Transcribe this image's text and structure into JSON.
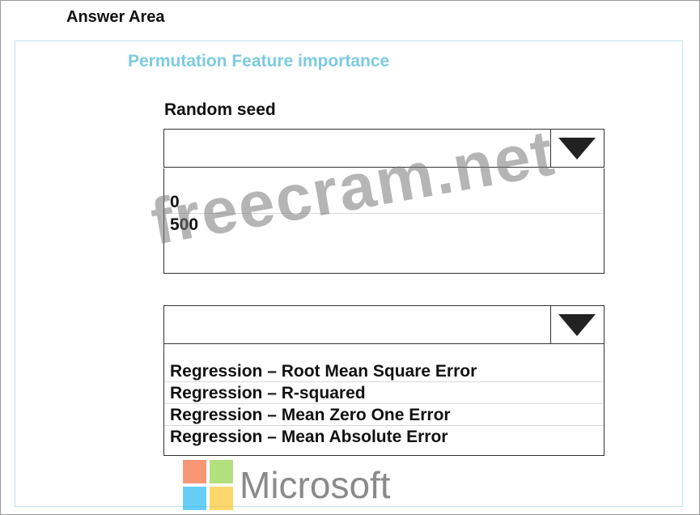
{
  "answer_area_title": "Answer Area",
  "section_title": "Permutation Feature importance",
  "random_seed": {
    "label": "Random seed",
    "selected": "",
    "options": [
      "0",
      "500"
    ]
  },
  "metric": {
    "selected": "",
    "options": [
      "Regression – Root Mean Square Error",
      "Regression – R-squared",
      "Regression – Mean Zero One Error",
      "Regression – Mean Absolute Error"
    ]
  },
  "watermark": "freecram.net",
  "logo": {
    "text": "Microsoft",
    "colors": [
      "#f1511b",
      "#80cc28",
      "#00adef",
      "#fbbc09"
    ]
  },
  "colors": {
    "section_title": "#7ccbe0",
    "inner_border": "#bfe3ee"
  }
}
